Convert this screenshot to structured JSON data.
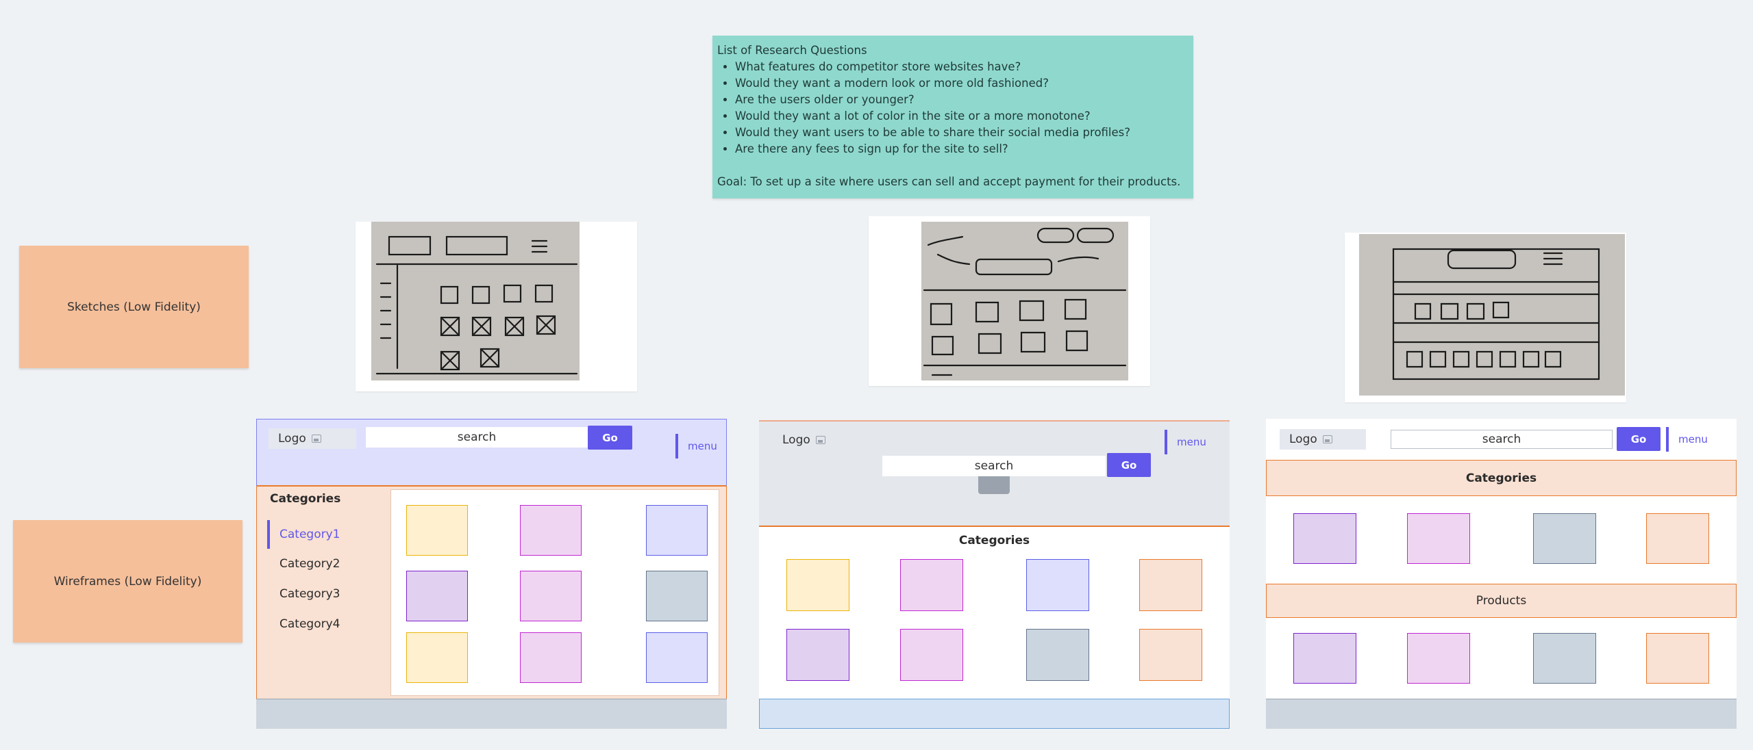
{
  "research_note": {
    "title": "List of Research Questions",
    "questions": [
      "What features do competitor store websites  have?",
      "Would they want a modern look or more old fashioned?",
      "Are the users older or younger?",
      "Would they want a lot of color in the site or a more monotone?",
      "Would they want users to be able to share their social media profiles?",
      "Are there any fees to sign up for the site to sell?"
    ],
    "goal": "Goal: To set up a site where users can sell and accept payment for their products."
  },
  "labels": {
    "sketches": "Sketches (Low Fidelity)",
    "wireframes": "Wireframes (Low Fidelity)"
  },
  "wireframe1": {
    "logo": "Logo",
    "search": "search",
    "go": "Go",
    "menu": "menu",
    "categories_title": "Categories",
    "categories": [
      "Category1",
      "Category2",
      "Category3",
      "Category4"
    ]
  },
  "wireframe2": {
    "logo": "Logo",
    "search": "search",
    "go": "Go",
    "menu": "menu",
    "categories_title": "Categories"
  },
  "wireframe3": {
    "logo": "Logo",
    "search": "search",
    "go": "Go",
    "menu": "menu",
    "categories_title": "Categories",
    "products_title": "Products"
  },
  "colors": {
    "canvas": "#eff2f5",
    "accent": "#6157ea",
    "orange_note": "#f5bf9a",
    "teal_note": "#8fd8cd"
  }
}
